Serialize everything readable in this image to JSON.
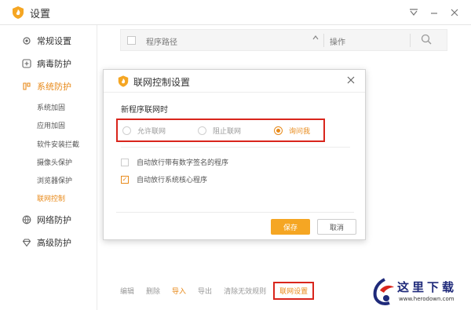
{
  "app": {
    "title": "设置"
  },
  "window_controls": [
    "minimize",
    "restore",
    "close"
  ],
  "sidebar": {
    "groups": [
      {
        "label": "常规设置",
        "icon": "gear-icon"
      },
      {
        "label": "病毒防护",
        "icon": "plus-box-icon"
      },
      {
        "label": "系统防护",
        "icon": "shield-icon",
        "active": true
      },
      {
        "label": "网络防护",
        "icon": "globe-icon"
      },
      {
        "label": "高级防护",
        "icon": "diamond-icon"
      }
    ],
    "subitems": [
      "系统加固",
      "应用加固",
      "软件安装拦截",
      "摄像头保护",
      "浏览器保护",
      "联网控制"
    ],
    "active_subitem": "联网控制"
  },
  "table": {
    "col_path": "程序路径",
    "col_op": "操作",
    "sort_icon": "chevron-up-icon",
    "search_icon": "search-icon"
  },
  "bottom_bar": {
    "edit": "编辑",
    "delete": "删除",
    "import": "导入",
    "export": "导出",
    "clear_invalid": "清除无效规则",
    "network_settings": "联网设置"
  },
  "dialog": {
    "title": "联网控制设置",
    "section_label": "新程序联网时",
    "radios": {
      "allow": "允许联网",
      "block": "阻止联网",
      "ask": "询问我"
    },
    "selected_radio": "询问我",
    "checkbox_signed": {
      "label": "自动放行带有数字签名的程序",
      "checked": false
    },
    "checkbox_core": {
      "label": "自动放行系统核心程序",
      "checked": true
    },
    "save": "保存",
    "cancel": "取消"
  },
  "watermark": {
    "text": "这里下载",
    "url": "www.herodown.com"
  },
  "colors": {
    "accent": "#e88a1a",
    "highlight_red": "#d9251c",
    "save_button": "#f5a623"
  }
}
